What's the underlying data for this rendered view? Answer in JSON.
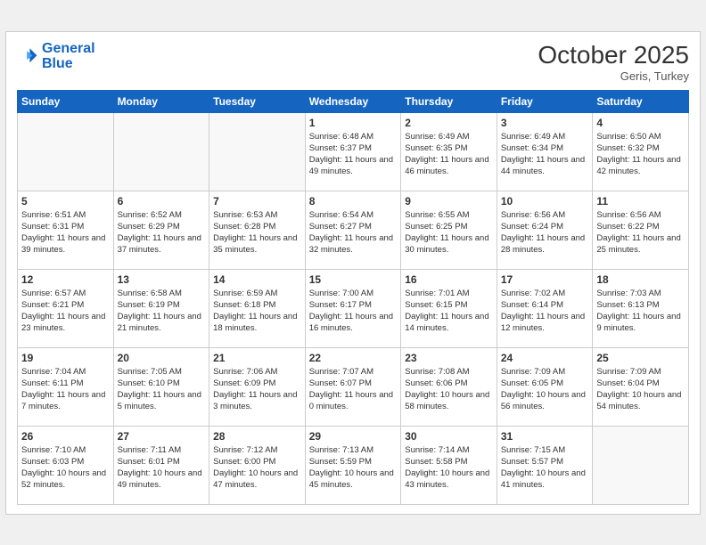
{
  "header": {
    "logo_line1": "General",
    "logo_line2": "Blue",
    "month_title": "October 2025",
    "subtitle": "Geris, Turkey"
  },
  "weekdays": [
    "Sunday",
    "Monday",
    "Tuesday",
    "Wednesday",
    "Thursday",
    "Friday",
    "Saturday"
  ],
  "weeks": [
    [
      {
        "day": "",
        "info": ""
      },
      {
        "day": "",
        "info": ""
      },
      {
        "day": "",
        "info": ""
      },
      {
        "day": "1",
        "info": "Sunrise: 6:48 AM\nSunset: 6:37 PM\nDaylight: 11 hours\nand 49 minutes."
      },
      {
        "day": "2",
        "info": "Sunrise: 6:49 AM\nSunset: 6:35 PM\nDaylight: 11 hours\nand 46 minutes."
      },
      {
        "day": "3",
        "info": "Sunrise: 6:49 AM\nSunset: 6:34 PM\nDaylight: 11 hours\nand 44 minutes."
      },
      {
        "day": "4",
        "info": "Sunrise: 6:50 AM\nSunset: 6:32 PM\nDaylight: 11 hours\nand 42 minutes."
      }
    ],
    [
      {
        "day": "5",
        "info": "Sunrise: 6:51 AM\nSunset: 6:31 PM\nDaylight: 11 hours\nand 39 minutes."
      },
      {
        "day": "6",
        "info": "Sunrise: 6:52 AM\nSunset: 6:29 PM\nDaylight: 11 hours\nand 37 minutes."
      },
      {
        "day": "7",
        "info": "Sunrise: 6:53 AM\nSunset: 6:28 PM\nDaylight: 11 hours\nand 35 minutes."
      },
      {
        "day": "8",
        "info": "Sunrise: 6:54 AM\nSunset: 6:27 PM\nDaylight: 11 hours\nand 32 minutes."
      },
      {
        "day": "9",
        "info": "Sunrise: 6:55 AM\nSunset: 6:25 PM\nDaylight: 11 hours\nand 30 minutes."
      },
      {
        "day": "10",
        "info": "Sunrise: 6:56 AM\nSunset: 6:24 PM\nDaylight: 11 hours\nand 28 minutes."
      },
      {
        "day": "11",
        "info": "Sunrise: 6:56 AM\nSunset: 6:22 PM\nDaylight: 11 hours\nand 25 minutes."
      }
    ],
    [
      {
        "day": "12",
        "info": "Sunrise: 6:57 AM\nSunset: 6:21 PM\nDaylight: 11 hours\nand 23 minutes."
      },
      {
        "day": "13",
        "info": "Sunrise: 6:58 AM\nSunset: 6:19 PM\nDaylight: 11 hours\nand 21 minutes."
      },
      {
        "day": "14",
        "info": "Sunrise: 6:59 AM\nSunset: 6:18 PM\nDaylight: 11 hours\nand 18 minutes."
      },
      {
        "day": "15",
        "info": "Sunrise: 7:00 AM\nSunset: 6:17 PM\nDaylight: 11 hours\nand 16 minutes."
      },
      {
        "day": "16",
        "info": "Sunrise: 7:01 AM\nSunset: 6:15 PM\nDaylight: 11 hours\nand 14 minutes."
      },
      {
        "day": "17",
        "info": "Sunrise: 7:02 AM\nSunset: 6:14 PM\nDaylight: 11 hours\nand 12 minutes."
      },
      {
        "day": "18",
        "info": "Sunrise: 7:03 AM\nSunset: 6:13 PM\nDaylight: 11 hours\nand 9 minutes."
      }
    ],
    [
      {
        "day": "19",
        "info": "Sunrise: 7:04 AM\nSunset: 6:11 PM\nDaylight: 11 hours\nand 7 minutes."
      },
      {
        "day": "20",
        "info": "Sunrise: 7:05 AM\nSunset: 6:10 PM\nDaylight: 11 hours\nand 5 minutes."
      },
      {
        "day": "21",
        "info": "Sunrise: 7:06 AM\nSunset: 6:09 PM\nDaylight: 11 hours\nand 3 minutes."
      },
      {
        "day": "22",
        "info": "Sunrise: 7:07 AM\nSunset: 6:07 PM\nDaylight: 11 hours\nand 0 minutes."
      },
      {
        "day": "23",
        "info": "Sunrise: 7:08 AM\nSunset: 6:06 PM\nDaylight: 10 hours\nand 58 minutes."
      },
      {
        "day": "24",
        "info": "Sunrise: 7:09 AM\nSunset: 6:05 PM\nDaylight: 10 hours\nand 56 minutes."
      },
      {
        "day": "25",
        "info": "Sunrise: 7:09 AM\nSunset: 6:04 PM\nDaylight: 10 hours\nand 54 minutes."
      }
    ],
    [
      {
        "day": "26",
        "info": "Sunrise: 7:10 AM\nSunset: 6:03 PM\nDaylight: 10 hours\nand 52 minutes."
      },
      {
        "day": "27",
        "info": "Sunrise: 7:11 AM\nSunset: 6:01 PM\nDaylight: 10 hours\nand 49 minutes."
      },
      {
        "day": "28",
        "info": "Sunrise: 7:12 AM\nSunset: 6:00 PM\nDaylight: 10 hours\nand 47 minutes."
      },
      {
        "day": "29",
        "info": "Sunrise: 7:13 AM\nSunset: 5:59 PM\nDaylight: 10 hours\nand 45 minutes."
      },
      {
        "day": "30",
        "info": "Sunrise: 7:14 AM\nSunset: 5:58 PM\nDaylight: 10 hours\nand 43 minutes."
      },
      {
        "day": "31",
        "info": "Sunrise: 7:15 AM\nSunset: 5:57 PM\nDaylight: 10 hours\nand 41 minutes."
      },
      {
        "day": "",
        "info": ""
      }
    ]
  ]
}
